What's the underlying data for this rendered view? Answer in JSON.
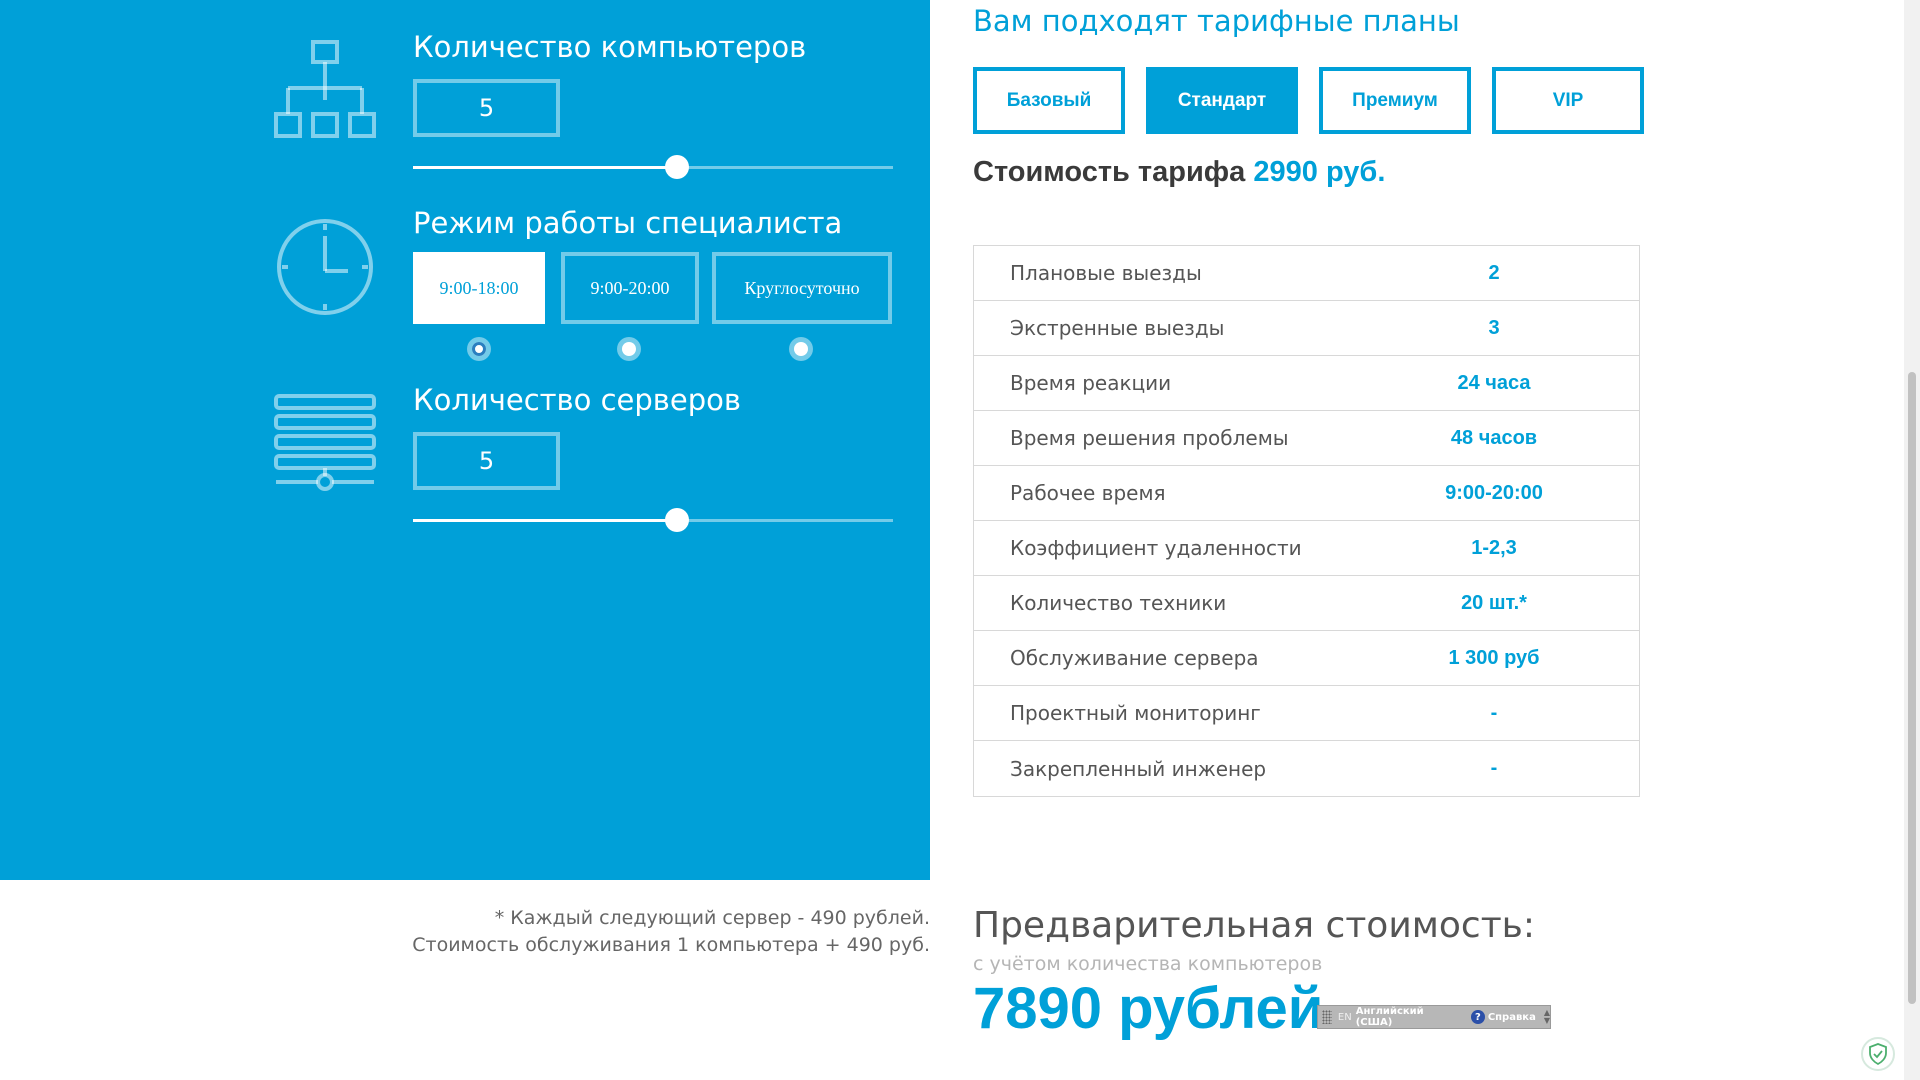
{
  "calculator": {
    "computers": {
      "title": "Количество компьютеров",
      "value": "5",
      "slider_level": 0.55
    },
    "mode": {
      "title": "Режим работы специалиста",
      "options": [
        "9:00-18:00",
        "9:00-20:00",
        "Круглосуточно"
      ],
      "selected_index": 0
    },
    "servers": {
      "title": "Количество серверов",
      "value": "5",
      "slider_level": 0.55
    }
  },
  "plans": {
    "heading": "Вам подходят тарифные планы",
    "buttons": [
      "Базовый",
      "Стандарт",
      "Премиум",
      "VIP"
    ],
    "active_index": 1,
    "price_label": "Стоимость тарифа",
    "price_value": "2990 руб."
  },
  "specs": [
    {
      "name": "Плановые выезды",
      "value": "2"
    },
    {
      "name": "Экстренные выезды",
      "value": "3"
    },
    {
      "name": "Время реакции",
      "value": "24 часа"
    },
    {
      "name": "Время решения проблемы",
      "value": "48 часов"
    },
    {
      "name": "Рабочее время",
      "value": "9:00-20:00"
    },
    {
      "name": "Коэффициент удаленности",
      "value": "1-2,3"
    },
    {
      "name": "Количество техники",
      "value": "20 шт.*"
    },
    {
      "name": "Обслуживание сервера",
      "value": "1 300 руб"
    },
    {
      "name": "Проектный мониторинг",
      "value": "-"
    },
    {
      "name": "Закрепленный инженер",
      "value": "-"
    }
  ],
  "notes": {
    "line1": "* Каждый следующий сервер - 490 рублей.",
    "line2": "Стоимость обслуживания 1 компьютера + 490 руб."
  },
  "total": {
    "title": "Предварительная стоимость:",
    "subtitle": "с учётом количества компьютеров",
    "value": "7890 рублей"
  },
  "language_bar": {
    "code": "EN",
    "name": "Английский (США)",
    "help": "Справка"
  },
  "colors": {
    "accent": "#00a0d8",
    "panel": "#00a0d8",
    "text_dark": "#3a3a3a"
  },
  "icons": [
    "network-icon",
    "clock-icon",
    "server-icon",
    "shield-icon",
    "help-icon"
  ]
}
